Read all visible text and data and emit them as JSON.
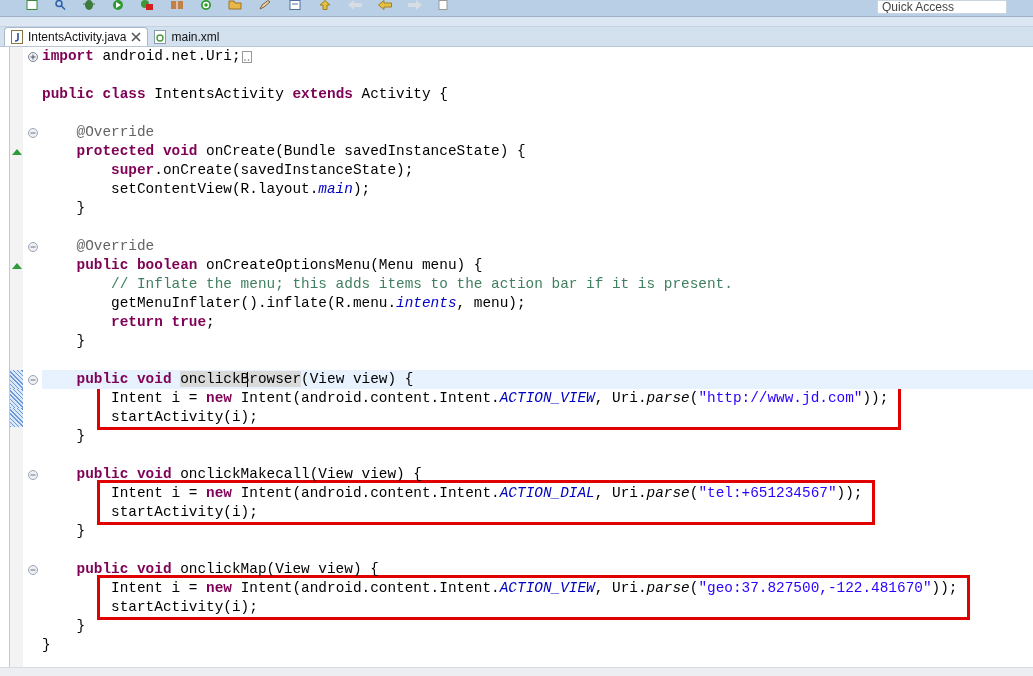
{
  "toolbar": {
    "quick_access": {
      "placeholder": "Quick Access"
    }
  },
  "tabs": [
    {
      "label": "IntentsActivity.java",
      "kind": "java",
      "selected": true,
      "closable": true
    },
    {
      "label": "main.xml",
      "kind": "xml",
      "selected": false,
      "closable": false
    }
  ],
  "editor": {
    "lines": [
      {
        "kind": "code",
        "fold_marker": true,
        "folded": true,
        "tokens": [
          {
            "kind": "keyword",
            "text": "import"
          },
          {
            "kind": "plain",
            "text": " android.net.Uri;"
          }
        ]
      },
      {
        "kind": "blank"
      },
      {
        "kind": "code",
        "tokens": [
          {
            "kind": "keyword",
            "text": "public "
          },
          {
            "kind": "keyword",
            "text": "class"
          },
          {
            "kind": "plain",
            "text": " IntentsActivity "
          },
          {
            "kind": "keyword",
            "text": "extends"
          },
          {
            "kind": "plain",
            "text": " Activity {"
          }
        ],
        "children": [
          {
            "kind": "blank"
          },
          {
            "kind": "code",
            "fold_marker": true,
            "folded": false,
            "tokens": [
              {
                "kind": "annotation",
                "text": "@Override"
              }
            ]
          },
          {
            "kind": "code",
            "override": true,
            "tokens": [
              {
                "kind": "keyword",
                "text": "protected "
              },
              {
                "kind": "keyword",
                "text": "void"
              },
              {
                "kind": "plain",
                "text": " onCreate(Bundle savedInstanceState) {"
              }
            ],
            "children": [
              {
                "kind": "code",
                "tokens": [
                  {
                    "kind": "keyword",
                    "text": "super"
                  },
                  {
                    "kind": "plain",
                    "text": ".onCreate(savedInstanceState);"
                  }
                ]
              },
              {
                "kind": "code",
                "tokens": [
                  {
                    "kind": "plain",
                    "text": "setContentView(R.layout."
                  },
                  {
                    "kind": "field",
                    "text": "main"
                  },
                  {
                    "kind": "plain",
                    "text": ");"
                  }
                ]
              }
            ]
          },
          {
            "kind": "code",
            "tokens": [
              {
                "kind": "plain",
                "text": "}"
              }
            ]
          },
          {
            "kind": "blank"
          },
          {
            "kind": "code",
            "fold_marker": true,
            "folded": false,
            "tokens": [
              {
                "kind": "annotation",
                "text": "@Override"
              }
            ]
          },
          {
            "kind": "code",
            "override": true,
            "tokens": [
              {
                "kind": "keyword",
                "text": "public "
              },
              {
                "kind": "keyword",
                "text": "boolean"
              },
              {
                "kind": "plain",
                "text": " onCreateOptionsMenu(Menu menu) {"
              }
            ],
            "children": [
              {
                "kind": "code",
                "tokens": [
                  {
                    "kind": "comment",
                    "text": "// Inflate the menu; this adds items to the action bar if it is present."
                  }
                ]
              },
              {
                "kind": "code",
                "tokens": [
                  {
                    "kind": "plain",
                    "text": "getMenuInflater().inflate(R.menu."
                  },
                  {
                    "kind": "field",
                    "text": "intents"
                  },
                  {
                    "kind": "plain",
                    "text": ", menu);"
                  }
                ]
              },
              {
                "kind": "code",
                "tokens": [
                  {
                    "kind": "keyword",
                    "text": "return "
                  },
                  {
                    "kind": "keyword",
                    "text": "true"
                  },
                  {
                    "kind": "plain",
                    "text": ";"
                  }
                ]
              }
            ]
          },
          {
            "kind": "code",
            "tokens": [
              {
                "kind": "plain",
                "text": "}"
              }
            ]
          },
          {
            "kind": "blank"
          },
          {
            "kind": "code",
            "fold_marker": true,
            "folded": false,
            "changed": true,
            "current": true,
            "tokens": [
              {
                "kind": "keyword",
                "text": "public "
              },
              {
                "kind": "keyword",
                "text": "void "
              },
              {
                "kind": "occurrence",
                "text": "onclickB"
              },
              {
                "kind": "occurrence",
                "text": "rowser",
                "caret_before": true
              },
              {
                "kind": "plain",
                "text": "(View view) {"
              }
            ],
            "children": [
              {
                "kind": "boxed",
                "lines": [
                  {
                    "changed": true,
                    "tokens": [
                      {
                        "kind": "plain",
                        "text": "Intent i = "
                      },
                      {
                        "kind": "keyword",
                        "text": "new"
                      },
                      {
                        "kind": "plain",
                        "text": " Intent(android.content.Intent."
                      },
                      {
                        "kind": "field",
                        "text": "ACTION_VIEW"
                      },
                      {
                        "kind": "plain",
                        "text": ", Uri."
                      },
                      {
                        "kind": "static_method",
                        "text": "parse"
                      },
                      {
                        "kind": "plain",
                        "text": "("
                      },
                      {
                        "kind": "string",
                        "text": "\"http://www.jd.com\""
                      },
                      {
                        "kind": "plain",
                        "text": "));"
                      }
                    ]
                  },
                  {
                    "changed": true,
                    "tokens": [
                      {
                        "kind": "plain",
                        "text": "startActivity(i);"
                      }
                    ]
                  }
                ]
              }
            ]
          },
          {
            "kind": "code",
            "tokens": [
              {
                "kind": "plain",
                "text": "}"
              }
            ]
          },
          {
            "kind": "blank"
          },
          {
            "kind": "code",
            "fold_marker": true,
            "folded": false,
            "tokens": [
              {
                "kind": "keyword",
                "text": "public "
              },
              {
                "kind": "keyword",
                "text": "void"
              },
              {
                "kind": "plain",
                "text": " onclickMakecall(View view) {"
              }
            ],
            "children": [
              {
                "kind": "boxed",
                "lines": [
                  {
                    "tokens": [
                      {
                        "kind": "plain",
                        "text": "Intent i = "
                      },
                      {
                        "kind": "keyword",
                        "text": "new"
                      },
                      {
                        "kind": "plain",
                        "text": " Intent(android.content.Intent."
                      },
                      {
                        "kind": "field",
                        "text": "ACTION_DIAL"
                      },
                      {
                        "kind": "plain",
                        "text": ", Uri."
                      },
                      {
                        "kind": "static_method",
                        "text": "parse"
                      },
                      {
                        "kind": "plain",
                        "text": "("
                      },
                      {
                        "kind": "string",
                        "text": "\"tel:+651234567\""
                      },
                      {
                        "kind": "plain",
                        "text": "));"
                      }
                    ]
                  },
                  {
                    "tokens": [
                      {
                        "kind": "plain",
                        "text": "startActivity(i);"
                      }
                    ]
                  }
                ]
              }
            ]
          },
          {
            "kind": "code",
            "tokens": [
              {
                "kind": "plain",
                "text": "}"
              }
            ]
          },
          {
            "kind": "blank"
          },
          {
            "kind": "code",
            "fold_marker": true,
            "folded": false,
            "tokens": [
              {
                "kind": "keyword",
                "text": "public "
              },
              {
                "kind": "keyword",
                "text": "void"
              },
              {
                "kind": "plain",
                "text": " onclickMap(View view) {"
              }
            ],
            "children": [
              {
                "kind": "boxed",
                "lines": [
                  {
                    "tokens": [
                      {
                        "kind": "plain",
                        "text": "Intent i = "
                      },
                      {
                        "kind": "keyword",
                        "text": "new"
                      },
                      {
                        "kind": "plain",
                        "text": " Intent(android.content.Intent."
                      },
                      {
                        "kind": "field",
                        "text": "ACTION_VIEW"
                      },
                      {
                        "kind": "plain",
                        "text": ", Uri."
                      },
                      {
                        "kind": "static_method",
                        "text": "parse"
                      },
                      {
                        "kind": "plain",
                        "text": "("
                      },
                      {
                        "kind": "string",
                        "text": "\"geo:37.827500,-122.481670\""
                      },
                      {
                        "kind": "plain",
                        "text": "));"
                      }
                    ]
                  },
                  {
                    "tokens": [
                      {
                        "kind": "plain",
                        "text": "startActivity(i);"
                      }
                    ]
                  }
                ]
              }
            ]
          },
          {
            "kind": "code",
            "tokens": [
              {
                "kind": "plain",
                "text": "}"
              }
            ]
          }
        ]
      },
      {
        "kind": "code",
        "tokens": [
          {
            "kind": "plain",
            "text": "}"
          }
        ]
      }
    ]
  }
}
